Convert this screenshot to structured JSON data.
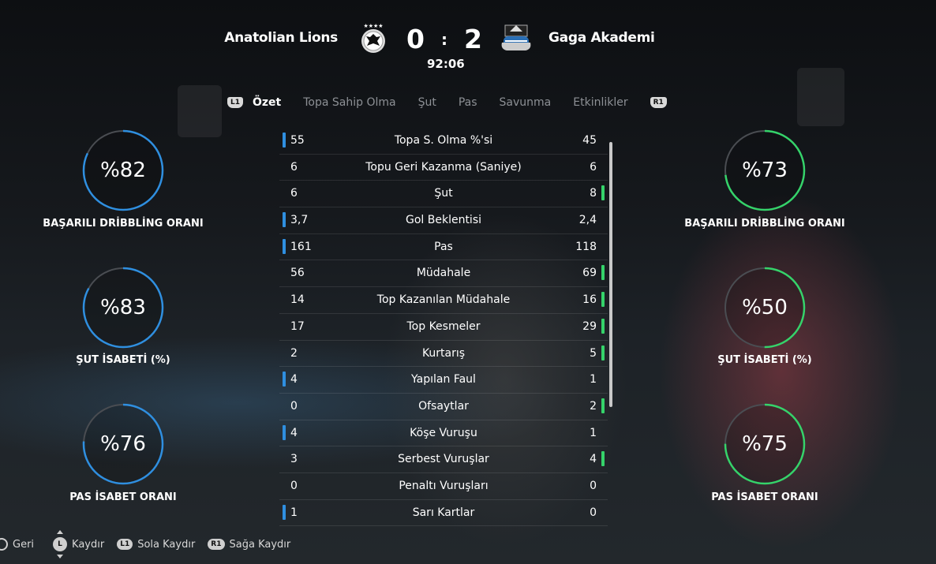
{
  "match": {
    "home_team": "Anatolian Lions",
    "away_team": "Gaga Akademi",
    "home_score": "0",
    "away_score": "2",
    "separator": ":",
    "clock": "92:06",
    "home_crest_icon": "eagle-crest-icon",
    "away_crest_icon": "magpie-crest-icon"
  },
  "tabs": {
    "prev_button": "L1",
    "next_button": "R1",
    "items": [
      "Özet",
      "Topa Sahip Olma",
      "Şut",
      "Pas",
      "Savunma",
      "Etkinlikler"
    ],
    "active_index": 0
  },
  "colors": {
    "home": "#2f8fe0",
    "away": "#35d36a",
    "ring_track": "#4a4d52"
  },
  "home_rings": [
    {
      "value": "%82",
      "label": "BAŞARILI DRİBBLİNG ORANI",
      "fraction": 0.82
    },
    {
      "value": "%83",
      "label": "ŞUT İSABETİ (%)",
      "fraction": 0.83
    },
    {
      "value": "%76",
      "label": "PAS İSABET ORANI",
      "fraction": 0.76
    }
  ],
  "away_rings": [
    {
      "value": "%73",
      "label": "BAŞARILI DRİBBLİNG ORANI",
      "fraction": 0.73
    },
    {
      "value": "%50",
      "label": "ŞUT İSABETİ (%)",
      "fraction": 0.5
    },
    {
      "value": "%75",
      "label": "PAS İSABET ORANI",
      "fraction": 0.75
    }
  ],
  "stats": [
    {
      "name": "Topa S. Olma %'si",
      "home": "55",
      "away": "45",
      "leader": "home"
    },
    {
      "name": "Topu Geri Kazanma (Saniye)",
      "home": "6",
      "away": "6",
      "leader": "none"
    },
    {
      "name": "Şut",
      "home": "6",
      "away": "8",
      "leader": "away"
    },
    {
      "name": "Gol Beklentisi",
      "home": "3,7",
      "away": "2,4",
      "leader": "home"
    },
    {
      "name": "Pas",
      "home": "161",
      "away": "118",
      "leader": "home"
    },
    {
      "name": "Müdahale",
      "home": "56",
      "away": "69",
      "leader": "away"
    },
    {
      "name": "Top Kazanılan Müdahale",
      "home": "14",
      "away": "16",
      "leader": "away"
    },
    {
      "name": "Top Kesmeler",
      "home": "17",
      "away": "29",
      "leader": "away"
    },
    {
      "name": "Kurtarış",
      "home": "2",
      "away": "5",
      "leader": "away"
    },
    {
      "name": "Yapılan Faul",
      "home": "4",
      "away": "1",
      "leader": "home"
    },
    {
      "name": "Ofsaytlar",
      "home": "0",
      "away": "2",
      "leader": "away"
    },
    {
      "name": "Köşe Vuruşu",
      "home": "4",
      "away": "1",
      "leader": "home"
    },
    {
      "name": "Serbest Vuruşlar",
      "home": "3",
      "away": "4",
      "leader": "away"
    },
    {
      "name": "Penaltı Vuruşları",
      "home": "0",
      "away": "0",
      "leader": "none"
    },
    {
      "name": "Sarı Kartlar",
      "home": "1",
      "away": "0",
      "leader": "home"
    }
  ],
  "footer": {
    "back": "Geri",
    "scroll_button": "L",
    "scroll": "Kaydır",
    "left_button": "L1",
    "scroll_left": "Sola Kaydır",
    "right_button": "R1",
    "scroll_right": "Sağa Kaydır"
  }
}
